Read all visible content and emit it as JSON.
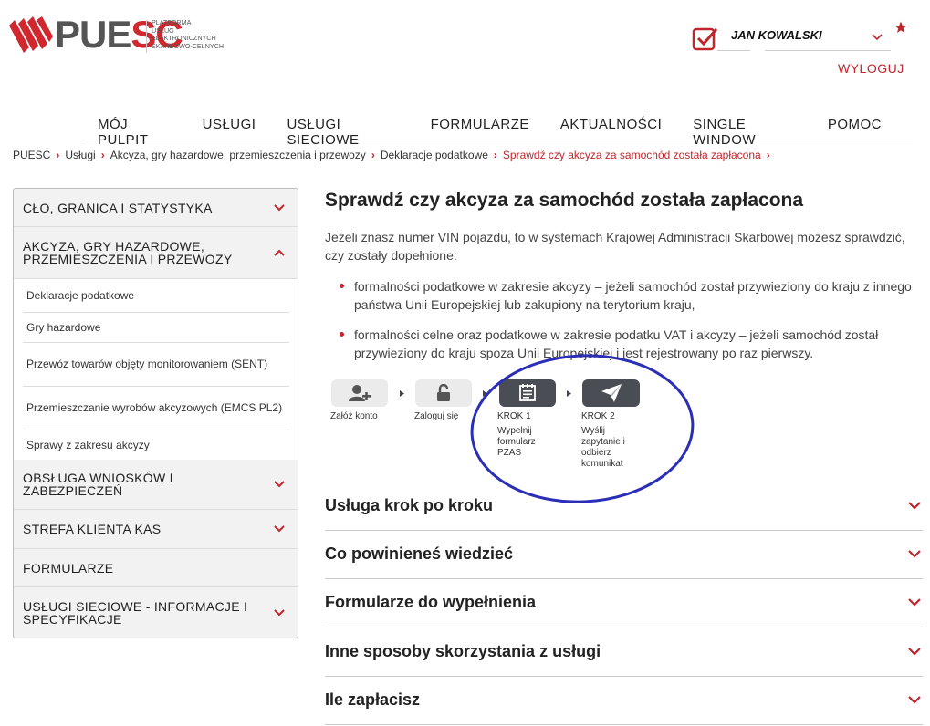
{
  "brand": {
    "logo_text_gray": "PUE",
    "logo_text_red": "SC",
    "logo_subtitle": [
      "PLATFORMA",
      "USŁUG",
      "ELEKTRONICZNYCH",
      "SKARBOWO-CELNYCH"
    ],
    "accent_color": "#c0262d"
  },
  "user": {
    "name": "JAN KOWALSKI",
    "logout_label": "WYLOGUJ",
    "icons": [
      "checkbox-check-icon",
      "chevron-down-icon",
      "star-icon"
    ]
  },
  "nav": {
    "items": [
      "MÓJ PULPIT",
      "USŁUGI",
      "USŁUGI SIECIOWE",
      "FORMULARZE",
      "AKTUALNOŚCI",
      "SINGLE WINDOW",
      "POMOC"
    ]
  },
  "breadcrumb": {
    "items": [
      "PUESC",
      "Usługi",
      "Akcyza, gry hazardowe, przemieszczenia i przewozy",
      "Deklaracje podatkowe"
    ],
    "current": "Sprawdź czy akcyza za samochód została zapłacona"
  },
  "sidebar": {
    "sections": [
      {
        "label": "CŁO, GRANICA I STATYSTYKA",
        "expanded": false
      },
      {
        "label": "AKCYZA, GRY HAZARDOWE, PRZEMIESZCZENIA I PRZEWOZY",
        "expanded": true
      },
      {
        "label": "OBSŁUGA WNIOSKÓW I ZABEZPIECZEŃ",
        "expanded": false
      },
      {
        "label": "STREFA KLIENTA KAS",
        "expanded": false
      },
      {
        "label": "FORMULARZE",
        "expanded": false
      },
      {
        "label": "USŁUGI SIECIOWE - INFORMACJE I SPECYFIKACJE",
        "expanded": false
      }
    ],
    "subitems": [
      "Deklaracje podatkowe",
      "Gry hazardowe",
      "Przewóz towarów objęty monitorowaniem (SENT)",
      "Przemieszczanie wyrobów akcyzowych (EMCS PL2)",
      "Sprawy z zakresu akcyzy"
    ]
  },
  "main": {
    "title": "Sprawdź czy akcyza za samochód została zapłacona",
    "intro": "Jeżeli znasz numer VIN pojazdu, to w systemach Krajowej Administracji Skarbowej możesz sprawdzić, czy zostały dopełnione:",
    "bullets": [
      "formalności podatkowe w zakresie akcyzy – jeżeli samochód został przywieziony do kraju z innego państwa Unii Europejskiej lub zakupiony na terytorium kraju,",
      "formalności celne oraz podatkowe w zakresie podatku VAT i akcyzy – jeżeli samochód został przywieziony do kraju spoza Unii Europejskiej i jest rejestrowany po raz pierwszy."
    ],
    "steps": [
      {
        "label": "Załóż konto",
        "icon": "add-user-icon"
      },
      {
        "label": "Zaloguj się",
        "icon": "unlock-icon"
      },
      {
        "label": "KROK 1",
        "desc": "Wypełnij formularz PZAS",
        "icon": "form-icon"
      },
      {
        "label": "KROK 2",
        "desc": "Wyślij zapytanie i odbierz komunikat",
        "icon": "send-icon"
      }
    ],
    "accordion": [
      "Usługa krok po kroku",
      "Co powinieneś wiedzieć",
      "Formularze do wypełnienia",
      "Inne sposoby skorzystania z usługi",
      "Ile zapłacisz"
    ],
    "annotation_color": "#2a2fb5"
  }
}
